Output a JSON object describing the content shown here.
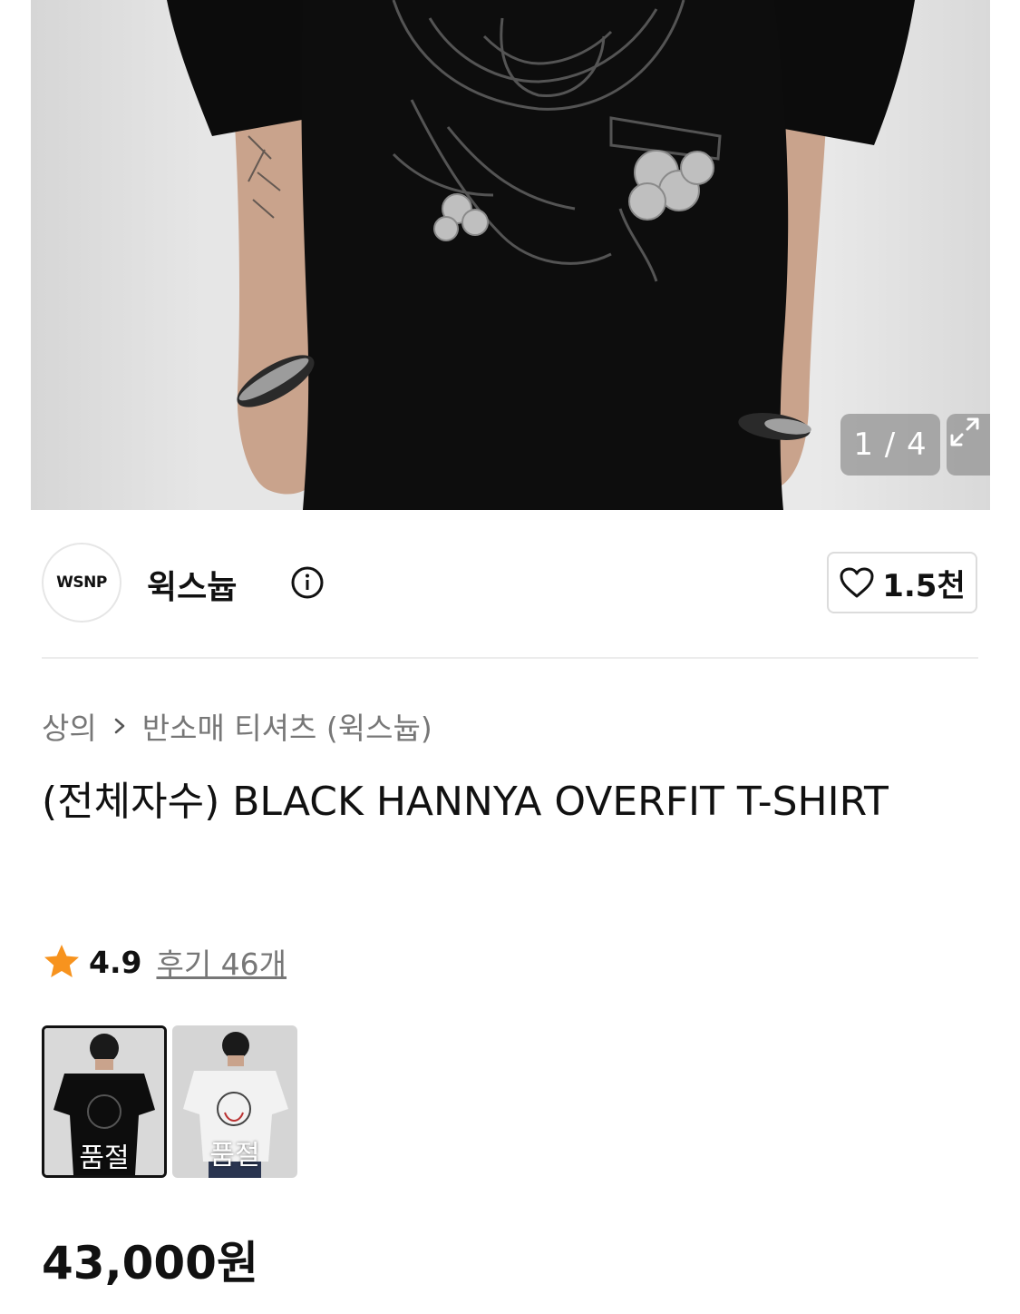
{
  "gallery": {
    "counter": "1 / 4",
    "expand_icon": "expand-icon"
  },
  "store": {
    "logo_text": "WSNP",
    "name": "윅스늅",
    "info_icon": "info-icon",
    "like_icon": "heart-outline-icon",
    "like_count": "1.5천"
  },
  "breadcrumb": {
    "level1": "상의",
    "separator_icon": "chevron-right-icon",
    "level2": "반소매 티셔츠 (윅스늅)"
  },
  "product": {
    "title": "(전체자수) BLACK HANNYA OVERFIT T-SHIRT",
    "rating": "4.9",
    "review_link": "후기 46개",
    "price": "43,000원"
  },
  "colors": {
    "star": "#F7931E",
    "text": "#111111",
    "muted": "#777777"
  },
  "variants": [
    {
      "status": "품절"
    },
    {
      "status": "품절"
    }
  ]
}
